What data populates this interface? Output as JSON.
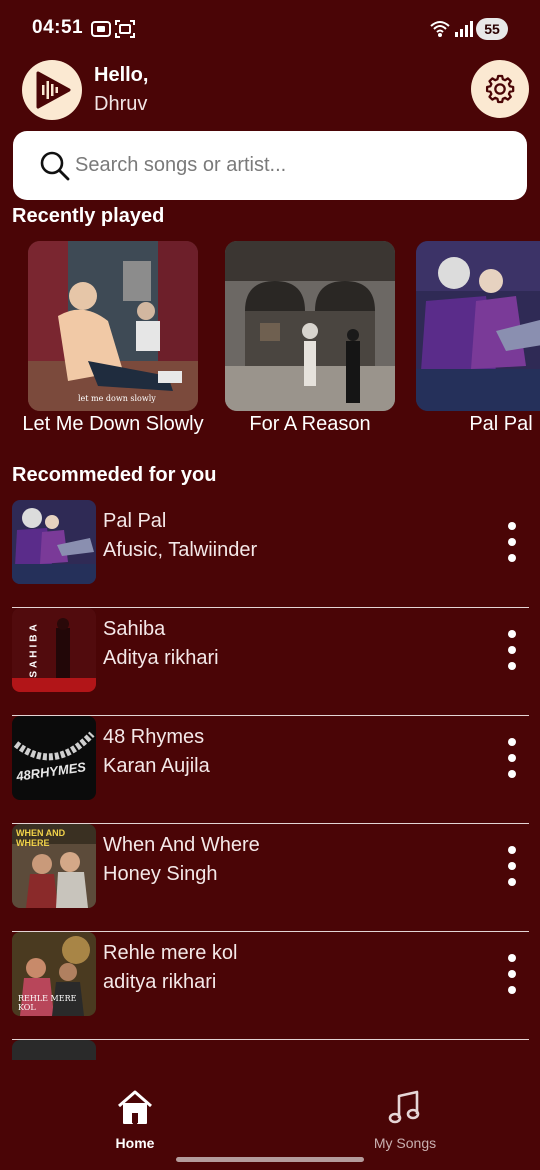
{
  "status_bar": {
    "time": "04:51",
    "battery": "55",
    "icons": [
      "screenshot-icon",
      "scan-icon",
      "wifi-icon",
      "signal-icon"
    ]
  },
  "header": {
    "greeting": "Hello,",
    "username": "Dhruv",
    "logo_icon": "music-wave-icon",
    "settings_icon": "gear-icon"
  },
  "search": {
    "placeholder": "Search songs or artist...",
    "value": ""
  },
  "recently_played": {
    "title": "Recently played",
    "items": [
      {
        "label": "Let Me Down Slowly",
        "cover_text": "let me down slowly"
      },
      {
        "label": "For A Reason",
        "cover_text": ""
      },
      {
        "label": "Pal Pal",
        "cover_text": ""
      }
    ]
  },
  "recommended": {
    "title": "Recommeded for you",
    "items": [
      {
        "title": "Pal Pal",
        "artist": "Afusic, Talwiinder",
        "cover_text": ""
      },
      {
        "title": "Sahiba",
        "artist": "Aditya rikhari",
        "cover_text": "SAHIBA"
      },
      {
        "title": "48 Rhymes",
        "artist": "Karan Aujila",
        "cover_text": "48RHYMES"
      },
      {
        "title": "When And Where",
        "artist": "Honey Singh",
        "cover_text": "WHEN AND WHERE"
      },
      {
        "title": "Rehle mere kol",
        "artist": "aditya rikhari",
        "cover_text": "REHLE MERE KOL"
      }
    ]
  },
  "nav": {
    "items": [
      {
        "label": "Home",
        "icon": "home-icon",
        "active": true
      },
      {
        "label": "My Songs",
        "icon": "music-note-icon",
        "active": false
      }
    ]
  },
  "colors": {
    "background": "#4a0506",
    "accent": "#fbe9d2",
    "divider": "#e4d4d4",
    "inactive_nav": "#c9b0b0"
  }
}
